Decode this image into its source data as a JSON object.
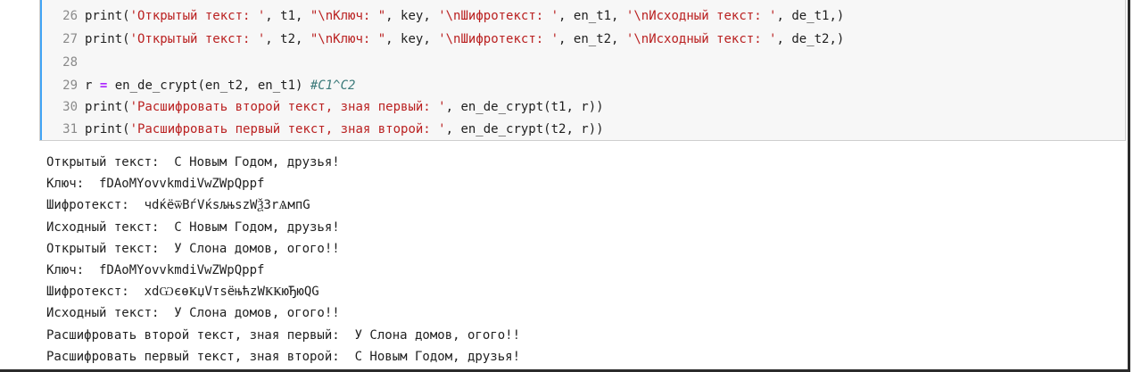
{
  "code_lines": [
    {
      "n": "26",
      "parts": [
        [
          "print(",
          "p"
        ],
        [
          "'Открытый текст: '",
          "s"
        ],
        [
          ", t1, ",
          "p"
        ],
        [
          "\"\\nКлюч: \"",
          "s"
        ],
        [
          ", key, ",
          "p"
        ],
        [
          "'\\nШифротекст: '",
          "s"
        ],
        [
          ", en_t1, ",
          "p"
        ],
        [
          "'\\nИсходный текст: '",
          "s"
        ],
        [
          ", de_t1,)",
          "p"
        ]
      ]
    },
    {
      "n": "27",
      "parts": [
        [
          "print(",
          "p"
        ],
        [
          "'Открытый текст: '",
          "s"
        ],
        [
          ", t2, ",
          "p"
        ],
        [
          "\"\\nКлюч: \"",
          "s"
        ],
        [
          ", key, ",
          "p"
        ],
        [
          "'\\nШифротекст: '",
          "s"
        ],
        [
          ", en_t2, ",
          "p"
        ],
        [
          "'\\nИсходный текст: '",
          "s"
        ],
        [
          ", de_t2,)",
          "p"
        ]
      ]
    },
    {
      "n": "28",
      "parts": []
    },
    {
      "n": "29",
      "parts": [
        [
          "r ",
          "p"
        ],
        [
          "=",
          "o"
        ],
        [
          " en_de_crypt(en_t2, en_t1) ",
          "p"
        ],
        [
          "#C1^C2",
          "c"
        ]
      ]
    },
    {
      "n": "30",
      "parts": [
        [
          "print(",
          "p"
        ],
        [
          "'Расшифровать второй текст, зная первый: '",
          "s"
        ],
        [
          ", en_de_crypt(t1, r))",
          "p"
        ]
      ]
    },
    {
      "n": "31",
      "parts": [
        [
          "print(",
          "p"
        ],
        [
          "'Расшифровать первый текст, зная второй: '",
          "s"
        ],
        [
          ", en_de_crypt(t2, r))",
          "p"
        ]
      ]
    }
  ],
  "output_lines": [
    "Открытый текст:  С Новым Годом, друзья!",
    "Ключ:  fDAoMYovvkmdiVwZWpQppf",
    "Шифротекст:  чdќёѿВѓVќѕљњѕzWѮЗrѦмпG",
    "Исходный текст:  С Новым Годом, друзья!",
    "Открытый текст:  У Слона домов, огого!!",
    "Ключ:  fDAoMYovvkmdiVwZWpQppf",
    "Шифротекст:  xdѠєѳҜџVтѕёњћzWҜҜюЂюQG",
    "Исходный текст:  У Слона домов, огого!!",
    "Расшифровать второй текст, зная первый:  У Слона домов, огого!!",
    "Расшифровать первый текст, зная второй:  С Новым Годом, друзья!"
  ]
}
